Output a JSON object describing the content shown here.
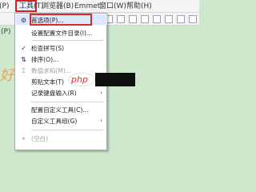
{
  "menubar": {
    "left_cut": "(P)",
    "tools": "工具(T)",
    "browser": "浏览器(B)",
    "emmet": "Emmet",
    "window": "窗口(W)",
    "help": "帮助(H)"
  },
  "editor": {
    "left_text": "(P)",
    "left_glyph": "好"
  },
  "tools_menu": {
    "items": [
      {
        "label": "首选项(P)...",
        "icon": "gear-icon",
        "enabled": true
      },
      {
        "label": "设置配置文件目录(I)...",
        "icon": "",
        "enabled": true
      },
      {
        "label": "检查拼写(S)",
        "icon": "spellcheck-icon",
        "enabled": true
      },
      {
        "label": "排序(O)...",
        "icon": "sort-icon",
        "enabled": true
      },
      {
        "label": "数值求和(M)...",
        "icon": "sum-icon",
        "enabled": false
      },
      {
        "label": "剪贴文本(T)",
        "icon": "",
        "enabled": true,
        "submenu": true
      },
      {
        "label": "记录键盘输入(R)",
        "icon": "",
        "enabled": true,
        "submenu": true
      },
      {
        "label": "配置自定义工具(C)...",
        "icon": "",
        "enabled": true
      },
      {
        "label": "自定义工具组(G)",
        "icon": "",
        "enabled": true,
        "submenu": true
      },
      {
        "label": "(空白)",
        "icon": "sparkle-icon",
        "enabled": false
      }
    ]
  },
  "watermark": {
    "text": "php"
  }
}
